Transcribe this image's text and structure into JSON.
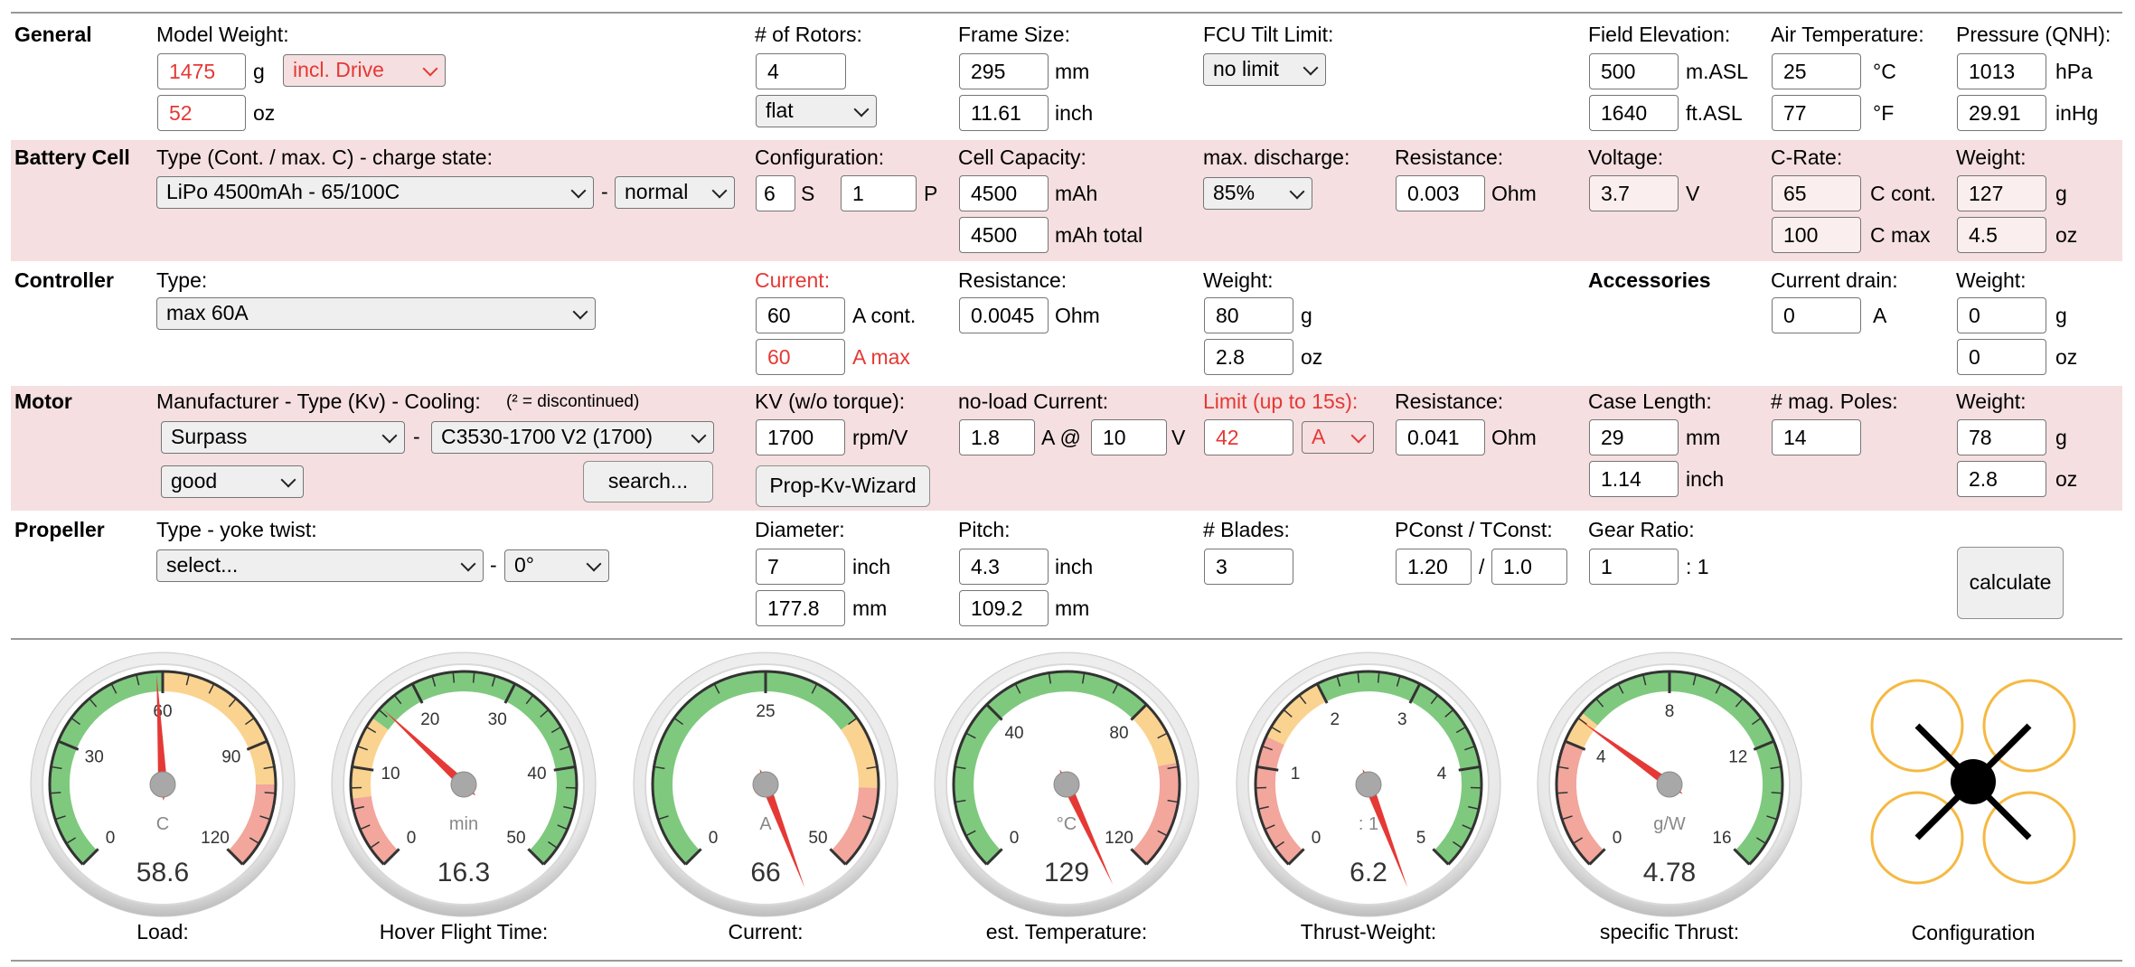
{
  "general": {
    "title": "General",
    "model_weight_label": "Model Weight:",
    "weight_g": "1475",
    "weight_unit_g": "g",
    "drive_select": "incl. Drive",
    "weight_oz": "52",
    "weight_unit_oz": "oz",
    "rotors_label": "# of Rotors:",
    "rotors": "4",
    "rotor_layout": "flat",
    "frame_label": "Frame Size:",
    "frame_mm": "295",
    "frame_mm_unit": "mm",
    "frame_inch": "11.61",
    "frame_inch_unit": "inch",
    "tilt_label": "FCU Tilt Limit:",
    "tilt_select": "no limit",
    "elev_label": "Field Elevation:",
    "elev_m": "500",
    "elev_m_unit": "m.ASL",
    "elev_ft": "1640",
    "elev_ft_unit": "ft.ASL",
    "air_label": "Air Temperature:",
    "air_c": "25",
    "air_c_unit": "°C",
    "air_f": "77",
    "air_f_unit": "°F",
    "pressure_label": "Pressure (QNH):",
    "pressure_hpa": "1013",
    "pressure_hpa_unit": "hPa",
    "pressure_inhg": "29.91",
    "pressure_inhg_unit": "inHg"
  },
  "battery": {
    "title": "Battery Cell",
    "type_label": "Type (Cont. / max. C) - charge state:",
    "type_select": "LiPo 4500mAh - 65/100C",
    "dash": "-",
    "charge_select": "normal",
    "config_label": "Configuration:",
    "series": "6",
    "series_unit": "S",
    "parallel": "1",
    "parallel_unit": "P",
    "capacity_label": "Cell Capacity:",
    "capacity": "4500",
    "capacity_unit": "mAh",
    "capacity_total": "4500",
    "capacity_total_unit": "mAh total",
    "discharge_label": "max. discharge:",
    "discharge_select": "85%",
    "resistance_label": "Resistance:",
    "resistance": "0.003",
    "resistance_unit": "Ohm",
    "voltage_label": "Voltage:",
    "voltage": "3.7",
    "voltage_unit": "V",
    "crate_label": "C-Rate:",
    "c_cont": "65",
    "c_cont_unit": "C cont.",
    "c_max": "100",
    "c_max_unit": "C max",
    "weight_label": "Weight:",
    "weight_g": "127",
    "weight_g_unit": "g",
    "weight_oz": "4.5",
    "weight_oz_unit": "oz"
  },
  "controller": {
    "title": "Controller",
    "type_label": "Type:",
    "type_select": "max 60A",
    "current_label": "Current:",
    "current_cont": "60",
    "current_cont_unit": "A cont.",
    "current_max": "60",
    "current_max_unit": "A max",
    "resistance_label": "Resistance:",
    "resistance": "0.0045",
    "resistance_unit": "Ohm",
    "weight_label": "Weight:",
    "weight_g": "80",
    "weight_g_unit": "g",
    "weight_oz": "2.8",
    "weight_oz_unit": "oz"
  },
  "accessories": {
    "title": "Accessories",
    "drain_label": "Current drain:",
    "drain": "0",
    "drain_unit": "A",
    "weight_label": "Weight:",
    "weight_g": "0",
    "weight_g_unit": "g",
    "weight_oz": "0",
    "weight_oz_unit": "oz"
  },
  "motor": {
    "title": "Motor",
    "type_label": "Manufacturer - Type (Kv) - Cooling:",
    "type_note": "(² = discontinued)",
    "manufacturer_select": "Surpass",
    "dash": "-",
    "model_select": "C3530-1700 V2 (1700)",
    "cooling_select": "good",
    "search_button": "search...",
    "kv_label": "KV (w/o torque):",
    "kv": "1700",
    "kv_unit": "rpm/V",
    "wizard_button": "Prop-Kv-Wizard",
    "noload_label": "no-load Current:",
    "noload_current": "1.8",
    "noload_at": "A @",
    "noload_voltage": "10",
    "noload_voltage_unit": "V",
    "limit_label": "Limit (up to 15s):",
    "limit": "42",
    "limit_select": "A",
    "resistance_label": "Resistance:",
    "resistance": "0.041",
    "resistance_unit": "Ohm",
    "case_label": "Case Length:",
    "case_mm": "29",
    "case_mm_unit": "mm",
    "case_inch": "1.14",
    "case_inch_unit": "inch",
    "poles_label": "# mag. Poles:",
    "poles": "14",
    "weight_label": "Weight:",
    "weight_g": "78",
    "weight_g_unit": "g",
    "weight_oz": "2.8",
    "weight_oz_unit": "oz"
  },
  "propeller": {
    "title": "Propeller",
    "type_label": "Type - yoke twist:",
    "type_select": "select...",
    "dash": "-",
    "twist_select": "0°",
    "diameter_label": "Diameter:",
    "diameter_inch": "7",
    "diameter_inch_unit": "inch",
    "diameter_mm": "177.8",
    "diameter_mm_unit": "mm",
    "pitch_label": "Pitch:",
    "pitch_inch": "4.3",
    "pitch_inch_unit": "inch",
    "pitch_mm": "109.2",
    "pitch_mm_unit": "mm",
    "blades_label": "# Blades:",
    "blades": "3",
    "pconst_label": "PConst / TConst:",
    "pconst": "1.20",
    "slash": "/",
    "tconst": "1.0",
    "gear_label": "Gear Ratio:",
    "gear": "1",
    "gear_unit": ": 1",
    "calculate_button": "calculate"
  },
  "gauges": [
    {
      "label": "Load:",
      "unit": "C",
      "value": "58.6",
      "ticks": [
        "0",
        "30",
        "60",
        "90",
        "120"
      ],
      "max": 120,
      "needle": 58.6,
      "bands": [
        {
          "from": 0,
          "to": 60,
          "color": "#7ec97e"
        },
        {
          "from": 60,
          "to": 100,
          "color": "#fad390"
        },
        {
          "from": 100,
          "to": 120,
          "color": "#f2a69c"
        }
      ]
    },
    {
      "label": "Hover Flight Time:",
      "unit": "min",
      "value": "16.3",
      "ticks": [
        "0",
        "10",
        "20",
        "30",
        "40",
        "50"
      ],
      "max": 50,
      "needle": 16.3,
      "bands": [
        {
          "from": 0,
          "to": 7,
          "color": "#f2a69c"
        },
        {
          "from": 7,
          "to": 15,
          "color": "#fad390"
        },
        {
          "from": 15,
          "to": 50,
          "color": "#7ec97e"
        }
      ]
    },
    {
      "label": "Current:",
      "unit": "A",
      "value": "66",
      "ticks": [
        "0",
        "25",
        "50"
      ],
      "max": 50,
      "needle": 66,
      "bands": [
        {
          "from": 0,
          "to": 35,
          "color": "#7ec97e"
        },
        {
          "from": 35,
          "to": 42,
          "color": "#fad390"
        },
        {
          "from": 42,
          "to": 50,
          "color": "#f2a69c"
        }
      ]
    },
    {
      "label": "est. Temperature:",
      "unit": "°C",
      "value": "129",
      "ticks": [
        "0",
        "40",
        "80",
        "120"
      ],
      "max": 120,
      "needle": 129,
      "bands": [
        {
          "from": 0,
          "to": 80,
          "color": "#7ec97e"
        },
        {
          "from": 80,
          "to": 95,
          "color": "#fad390"
        },
        {
          "from": 95,
          "to": 120,
          "color": "#f2a69c"
        }
      ]
    },
    {
      "label": "Thrust-Weight:",
      "unit": ": 1",
      "value": "6.2",
      "ticks": [
        "0",
        "1",
        "2",
        "3",
        "4",
        "5"
      ],
      "max": 5,
      "needle": 6.2,
      "bands": [
        {
          "from": 0,
          "to": 1.3,
          "color": "#f2a69c"
        },
        {
          "from": 1.3,
          "to": 2,
          "color": "#fad390"
        },
        {
          "from": 2,
          "to": 5,
          "color": "#7ec97e"
        }
      ]
    },
    {
      "label": "specific Thrust:",
      "unit": "g/W",
      "value": "4.78",
      "ticks": [
        "0",
        "4",
        "8",
        "12",
        "16"
      ],
      "max": 16,
      "needle": 4.78,
      "bands": [
        {
          "from": 0,
          "to": 4,
          "color": "#f2a69c"
        },
        {
          "from": 4,
          "to": 5,
          "color": "#fad390"
        },
        {
          "from": 5,
          "to": 16,
          "color": "#7ec97e"
        }
      ]
    }
  ],
  "configuration": {
    "label": "Configuration",
    "rotor_color": "#f5b942"
  }
}
